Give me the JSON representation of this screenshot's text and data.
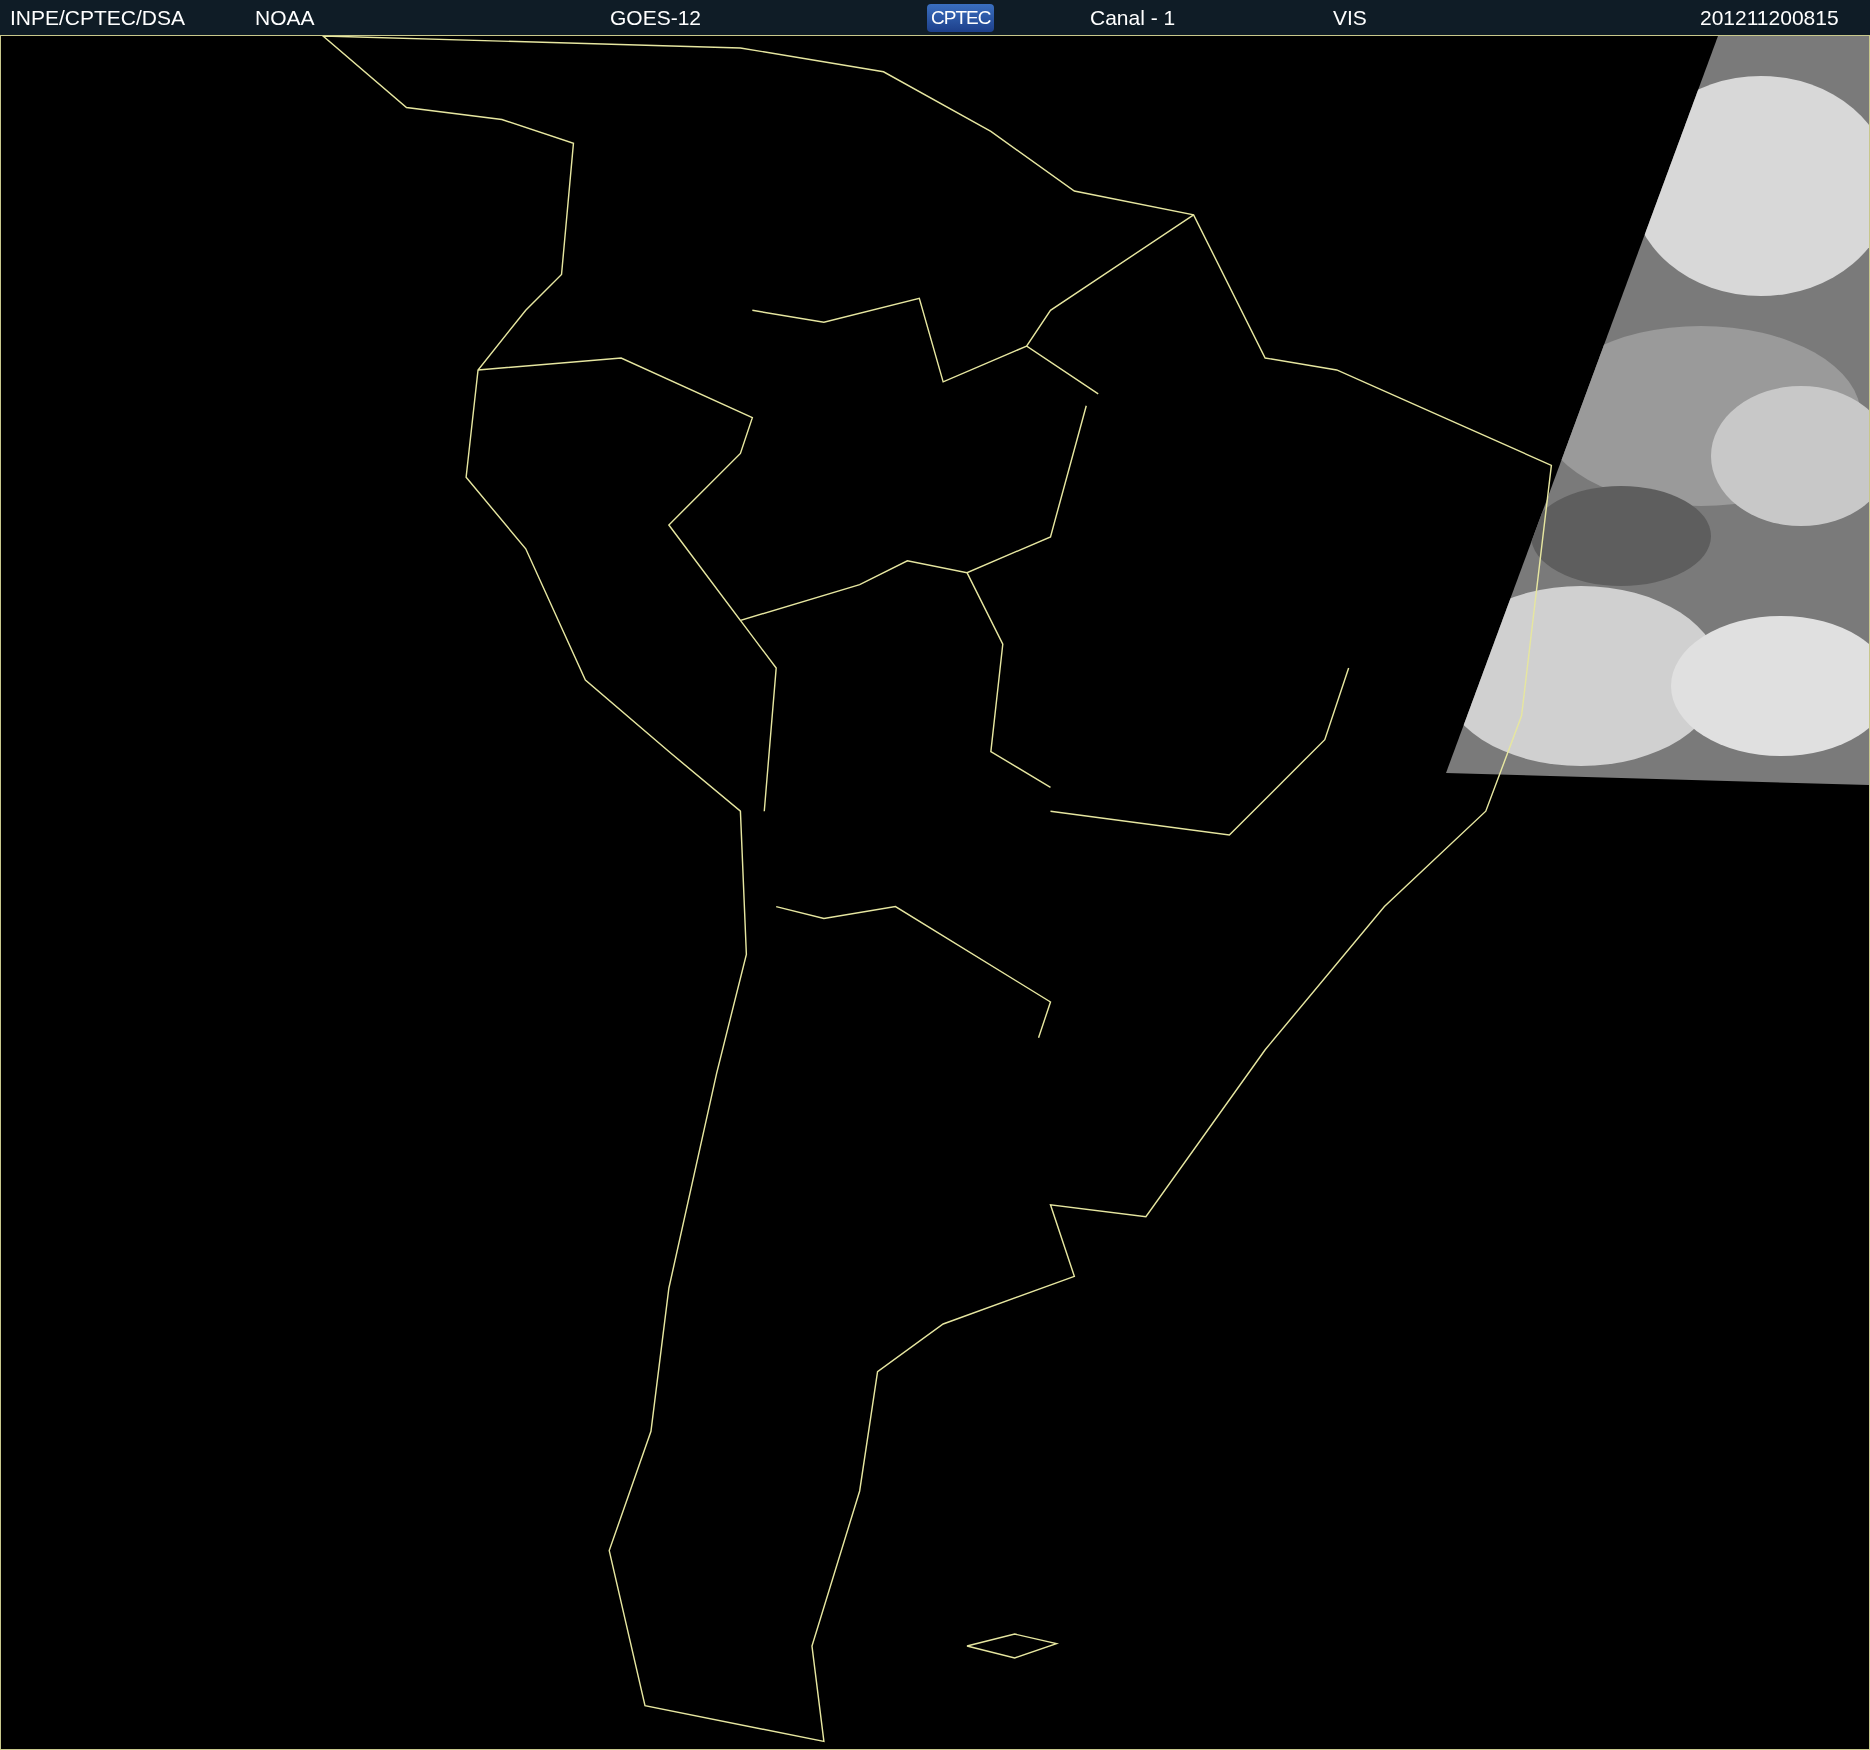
{
  "header": {
    "items": [
      {
        "kind": "text",
        "text": "INPE/CPTEC/DSA"
      },
      {
        "kind": "text",
        "text": "NOAA"
      },
      {
        "kind": "text",
        "text": "GOES-12"
      },
      {
        "kind": "logo",
        "text": "CPTEC"
      },
      {
        "kind": "text",
        "text": "Canal - 1"
      },
      {
        "kind": "text",
        "text": "VIS"
      },
      {
        "kind": "text",
        "text": "201211200815"
      }
    ]
  }
}
